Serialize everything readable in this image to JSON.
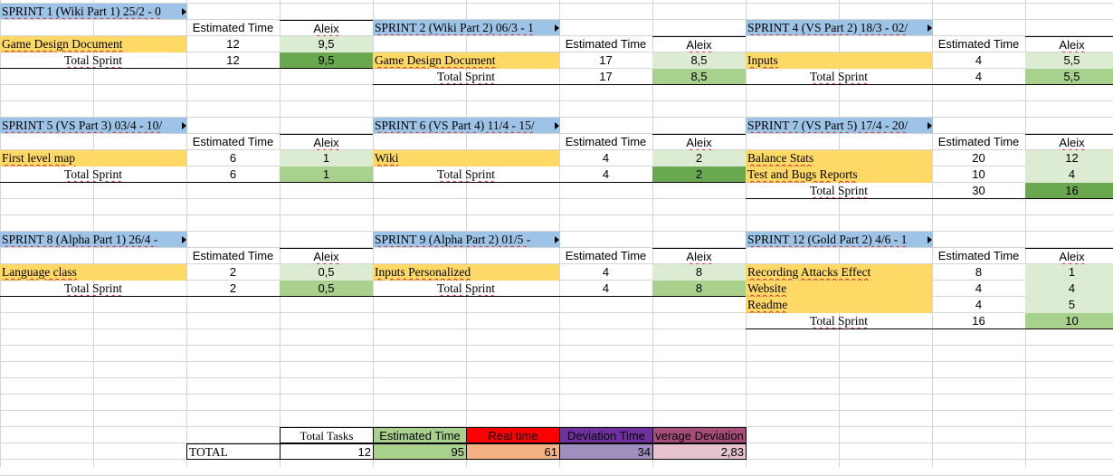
{
  "colors": {
    "title_bg": "#9dc3e6",
    "task_bg": "#ffd966",
    "aleix_light": "#dcecd3",
    "aleix_mid": "#a9d18e",
    "aleix_dark": "#6aa84f",
    "summary_estimated": "#a9d18e",
    "summary_real_head": "#ff0000",
    "summary_real_value": "#f4b183",
    "summary_deviation_head": "#7030a0",
    "summary_deviation_value": "#9e8fbf",
    "summary_avg_head": "#a64d79",
    "summary_avg_value": "#e6c3cf"
  },
  "headers": {
    "estimated_time": "Estimated Time",
    "aleix": "Aleix",
    "total_sprint": "Total Sprint"
  },
  "sprints": [
    {
      "title": "SPRINT 1 (Wiki Part 1) 25/2 - 0",
      "tasks": [
        {
          "name": "Game Design Document",
          "est": "12",
          "aleix": "9,5"
        }
      ],
      "total_est": "12",
      "total_aleix": "9,5"
    },
    {
      "title": "SPRINT 2 (Wiki Part 2) 06/3 - 1",
      "tasks": [
        {
          "name": "Game Design Document",
          "est": "17",
          "aleix": "8,5"
        }
      ],
      "total_est": "17",
      "total_aleix": "8,5"
    },
    {
      "title": "SPRINT 4 (VS Part 2) 18/3 - 02/",
      "tasks": [
        {
          "name": "Inputs",
          "est": "4",
          "aleix": "5,5"
        }
      ],
      "total_est": "4",
      "total_aleix": "5,5"
    },
    {
      "title": "SPRINT 5 (VS Part 3) 03/4 - 10/",
      "tasks": [
        {
          "name": "First level map",
          "est": "6",
          "aleix": "1"
        }
      ],
      "total_est": "6",
      "total_aleix": "1"
    },
    {
      "title": "SPRINT 6 (VS Part 4) 11/4 - 15/",
      "tasks": [
        {
          "name": "Wiki",
          "est": "4",
          "aleix": "2"
        }
      ],
      "total_est": "4",
      "total_aleix": "2"
    },
    {
      "title": "SPRINT 7 (VS Part 5) 17/4 - 20/",
      "tasks": [
        {
          "name": "Balance Stats",
          "est": "20",
          "aleix": "12"
        },
        {
          "name": "Test and Bugs Reports",
          "est": "10",
          "aleix": "4"
        }
      ],
      "total_est": "30",
      "total_aleix": "16"
    },
    {
      "title": "SPRINT 8 (Alpha Part 1) 26/4 -",
      "tasks": [
        {
          "name": "Language class",
          "est": "2",
          "aleix": "0,5"
        }
      ],
      "total_est": "2",
      "total_aleix": "0,5"
    },
    {
      "title": "SPRINT 9 (Alpha Part 2) 01/5 -",
      "tasks": [
        {
          "name": "Inputs Personalized",
          "est": "4",
          "aleix": "8"
        }
      ],
      "total_est": "4",
      "total_aleix": "8"
    },
    {
      "title": "SPRINT 12 (Gold Part 2) 4/6 - 1",
      "tasks": [
        {
          "name": "Recording Attacks Effect",
          "est": "8",
          "aleix": "1"
        },
        {
          "name": "Website",
          "est": "4",
          "aleix": "4"
        },
        {
          "name": "Readme",
          "est": "4",
          "aleix": "5"
        }
      ],
      "total_est": "16",
      "total_aleix": "10"
    }
  ],
  "summary": {
    "total_label": "TOTAL",
    "headers": [
      "Total Tasks",
      "Estimated Time",
      "Real time",
      "Deviation Time",
      "verage Deviation"
    ],
    "values": [
      "12",
      "95",
      "61",
      "34",
      "2,83"
    ]
  }
}
